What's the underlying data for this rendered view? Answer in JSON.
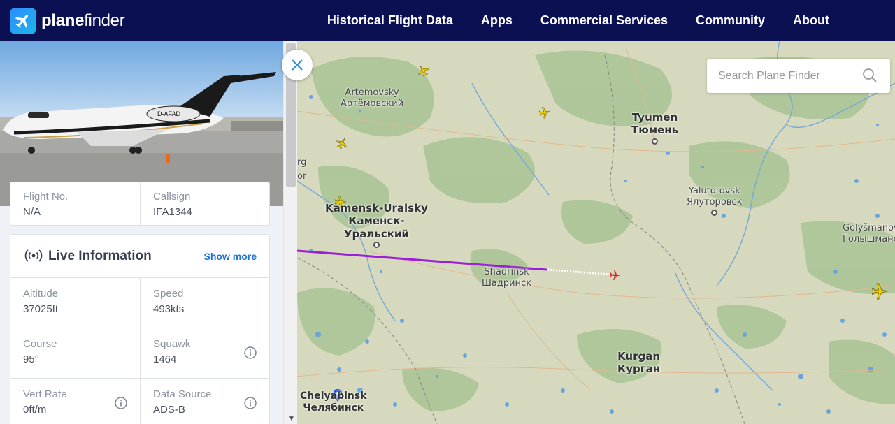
{
  "header": {
    "brand_bold": "plane",
    "brand_light": "finder",
    "nav": [
      "Historical Flight Data",
      "Apps",
      "Commercial Services",
      "Community",
      "About"
    ]
  },
  "aircraft_photo": {
    "registration": "D-AFAD"
  },
  "flight_card": {
    "flight_no_label": "Flight No.",
    "flight_no_value": "N/A",
    "callsign_label": "Callsign",
    "callsign_value": "IFA1344"
  },
  "live_info": {
    "title": "Live Information",
    "show_more": "Show more",
    "altitude_label": "Altitude",
    "altitude_value": "37025ft",
    "speed_label": "Speed",
    "speed_value": "493kts",
    "course_label": "Course",
    "course_value": "95°",
    "squawk_label": "Squawk",
    "squawk_value": "1464",
    "vert_rate_label": "Vert Rate",
    "vert_rate_value": "0ft/m",
    "data_source_label": "Data Source",
    "data_source_value": "ADS-B"
  },
  "search": {
    "placeholder": "Search Plane Finder"
  },
  "map": {
    "partial_label_1": "rg",
    "partial_label_2": "or",
    "cities": {
      "artemovsky_en": "Artemovsky",
      "artemovsky_ru": "Артёмовский",
      "tyumen_en": "Tyumen",
      "tyumen_ru": "Тюмень",
      "kamensk_en": "Kamensk-Uralsky",
      "kamensk_ru1": "Каменск-",
      "kamensk_ru2": "Уральский",
      "yalutorovsk_en": "Yalutorovsk",
      "yalutorovsk_ru": "Ялуторовск",
      "golyshmanovo_en": "Golyšmanovo",
      "golyshmanovo_ru": "Голышманово",
      "shadrinsk_en": "Shadrinsk",
      "shadrinsk_ru": "Шадринск",
      "kurgan_en": "Kurgan",
      "kurgan_ru": "Курган",
      "chelyabinsk_en": "Chelyabinsk",
      "chelyabinsk_ru": "Челябинск"
    },
    "colors": {
      "track": "#9b1fd8",
      "aircraft_selected": "#d2302b",
      "aircraft_other": "#f0d000"
    }
  }
}
